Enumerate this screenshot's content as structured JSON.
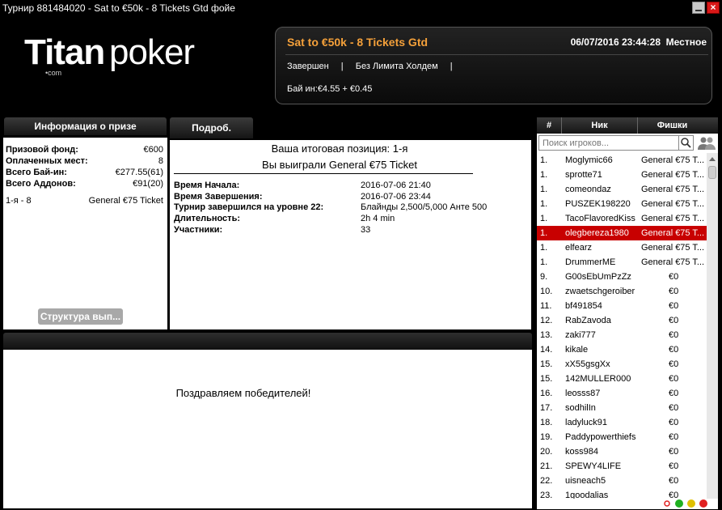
{
  "window": {
    "title": "Турнир 881484020 - Sat to €50k - 8 Tickets Gtd фойе",
    "close_glyph": "×"
  },
  "logo": {
    "part1": "Titan",
    "part2": "poker",
    "suffix": "•com"
  },
  "header": {
    "title": "Sat to €50k - 8 Tickets Gtd",
    "datetime": "06/07/2016 23:44:28",
    "timezone": "Местное",
    "status": "Завершен",
    "sep": "|",
    "game": "Без Лимита Холдем",
    "buyin": "Бай ин:€4.55 + €0.45"
  },
  "prize_info": {
    "heading": "Информация о призе",
    "rows": [
      {
        "label": "Призовой фонд:",
        "value": "€600"
      },
      {
        "label": "Оплаченных мест:",
        "value": "8"
      },
      {
        "label": "Всего Бай-ин:",
        "value": "€277.55(61)"
      },
      {
        "label": "Всего Аддонов:",
        "value": "€91(20)"
      }
    ],
    "place_label": "1-я - 8",
    "place_value": "General €75 Ticket",
    "structure_button": "Структура вып..."
  },
  "details": {
    "tab": "Подроб.",
    "position_line": "Ваша итоговая позиция: 1-я",
    "win_line": "Вы выиграли General €75 Ticket",
    "rows": [
      {
        "label": "Время Начала:",
        "value": "2016-07-06 21:40"
      },
      {
        "label": "Время Завершения:",
        "value": "2016-07-06 23:44"
      },
      {
        "label": "Турнир завершился на уровне 22:",
        "value": "Блайнды 2,500/5,000 Анте 500"
      },
      {
        "label": "Длительность:",
        "value": "2h 4 min"
      },
      {
        "label": "Участники:",
        "value": "33"
      }
    ]
  },
  "congrats": {
    "message": "Поздравляем победителей!"
  },
  "players": {
    "col_rank": "#",
    "col_nick": "Ник",
    "col_chips": "Фишки",
    "search_placeholder": "Поиск игроков...",
    "rows": [
      {
        "rank": "1.",
        "nick": "Moglymic66",
        "chips": "General €75 T..."
      },
      {
        "rank": "1.",
        "nick": "sprotte71",
        "chips": "General €75 T..."
      },
      {
        "rank": "1.",
        "nick": "comeondaz",
        "chips": "General €75 T..."
      },
      {
        "rank": "1.",
        "nick": "PUSZEK198220",
        "chips": "General €75 T..."
      },
      {
        "rank": "1.",
        "nick": "TacoFlavoredKiss",
        "chips": "General €75 T..."
      },
      {
        "rank": "1.",
        "nick": "olegbereza1980",
        "chips": "General €75 T...",
        "selected": true
      },
      {
        "rank": "1.",
        "nick": "elfearz",
        "chips": "General €75 T..."
      },
      {
        "rank": "1.",
        "nick": "DrummerME",
        "chips": "General €75 T..."
      },
      {
        "rank": "9.",
        "nick": "G00sEbUmPzZz",
        "chips": "€0"
      },
      {
        "rank": "10.",
        "nick": "zwaetschgeroiber",
        "chips": "€0"
      },
      {
        "rank": "11.",
        "nick": "bf491854",
        "chips": "€0"
      },
      {
        "rank": "12.",
        "nick": "RabZavoda",
        "chips": "€0"
      },
      {
        "rank": "13.",
        "nick": "zaki777",
        "chips": "€0"
      },
      {
        "rank": "14.",
        "nick": "kikale",
        "chips": "€0"
      },
      {
        "rank": "15.",
        "nick": "xX55gsgXx",
        "chips": "€0"
      },
      {
        "rank": "15.",
        "nick": "142MULLER000",
        "chips": "€0"
      },
      {
        "rank": "16.",
        "nick": "leosss87",
        "chips": "€0"
      },
      {
        "rank": "17.",
        "nick": "sodhilIn",
        "chips": "€0"
      },
      {
        "rank": "18.",
        "nick": "ladyluck91",
        "chips": "€0"
      },
      {
        "rank": "19.",
        "nick": "Paddypowerthiefs",
        "chips": "€0"
      },
      {
        "rank": "20.",
        "nick": "koss984",
        "chips": "€0"
      },
      {
        "rank": "21.",
        "nick": "SPEWY4LIFE",
        "chips": "€0"
      },
      {
        "rank": "22.",
        "nick": "uisneach5",
        "chips": "€0"
      },
      {
        "rank": "23.",
        "nick": "1goodalias",
        "chips": "€0"
      }
    ]
  },
  "colors": {
    "accent_orange": "#f4a03a",
    "selected_row": "#c80000",
    "status_red": "#e02020",
    "status_green": "#20b020",
    "status_yellow": "#e0c000"
  }
}
